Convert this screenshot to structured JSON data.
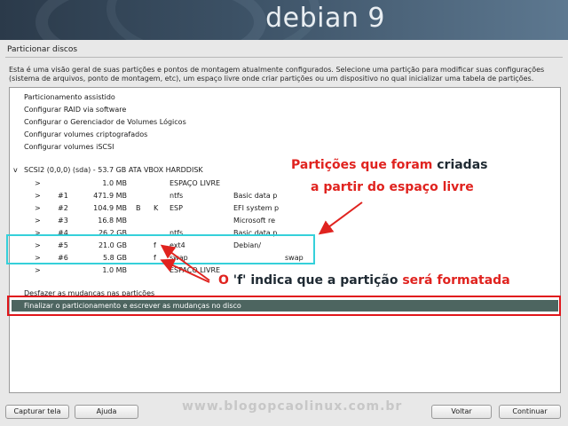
{
  "header": {
    "brand": "debian",
    "version": "9"
  },
  "page": {
    "title": "Particionar discos",
    "description": "Esta é uma visão geral de suas partições e pontos de montagem atualmente configurados. Selecione uma partição para modificar suas configurações (sistema de arquivos, ponto de montagem, etc), um espaço livre onde criar partições ou um dispositivo no qual inicializar uma tabela de partições."
  },
  "menu_items": [
    "Particionamento assistido",
    "Configurar RAID via software",
    "Configurar o Gerenciador de Volumes Lógicos",
    "Configurar volumes criptografados",
    "Configurar volumes iSCSI"
  ],
  "disk": {
    "expander": "v",
    "label": "SCSI2 (0,0,0) (sda) - 53.7 GB ATA VBOX HARDDISK"
  },
  "partitions": [
    {
      "arrow": ">",
      "num": "",
      "size": "1.0 MB",
      "format": "",
      "flags": "",
      "fs": "ESPAÇO LIVRE",
      "name": "",
      "mount": ""
    },
    {
      "arrow": ">",
      "num": "#1",
      "size": "471.9 MB",
      "format": "",
      "flags": "",
      "fs": "ntfs",
      "name": "Basic data p",
      "mount": ""
    },
    {
      "arrow": ">",
      "num": "#2",
      "size": "104.9 MB",
      "format": "B",
      "flags": "K",
      "fs": "ESP",
      "name": "EFI system p",
      "mount": ""
    },
    {
      "arrow": ">",
      "num": "#3",
      "size": "16.8 MB",
      "format": "",
      "flags": "",
      "fs": "",
      "name": "Microsoft re",
      "mount": ""
    },
    {
      "arrow": ">",
      "num": "#4",
      "size": "26.2 GB",
      "format": "",
      "flags": "",
      "fs": "ntfs",
      "name": "Basic data p",
      "mount": ""
    },
    {
      "arrow": ">",
      "num": "#5",
      "size": "21.0 GB",
      "format": "f",
      "flags": "",
      "fs": "ext4",
      "name": "Debian/",
      "mount": ""
    },
    {
      "arrow": ">",
      "num": "#6",
      "size": "5.8 GB",
      "format": "f",
      "flags": "",
      "fs": "swap",
      "name": "",
      "mount": "swap"
    },
    {
      "arrow": ">",
      "num": "",
      "size": "1.0 MB",
      "format": "",
      "flags": "",
      "fs": "ESPAÇO LIVRE",
      "name": "",
      "mount": ""
    }
  ],
  "actions": {
    "undo": "Desfazer as mudanças nas partições",
    "finish": "Finalizar o particionamento e escrever as mudanças no disco"
  },
  "annotations": {
    "created_line1_a": "Partições que foram",
    "created_line1_b": "criadas",
    "created_line2": "a partir do espaço livre",
    "format_a": "O",
    "format_b": "'f'",
    "format_c": "indica que a partição",
    "format_d": "será formatada"
  },
  "buttons": {
    "screenshot": "Capturar tela",
    "help": "Ajuda",
    "back": "Voltar",
    "continue": "Continuar"
  },
  "watermark": "www.blogopcaolinux.com.br",
  "colors": {
    "annotation_red": "#e0231f",
    "highlight_cyan": "#35d0da",
    "selection_bg": "#4d6560",
    "selection_border": "#e0161b"
  }
}
